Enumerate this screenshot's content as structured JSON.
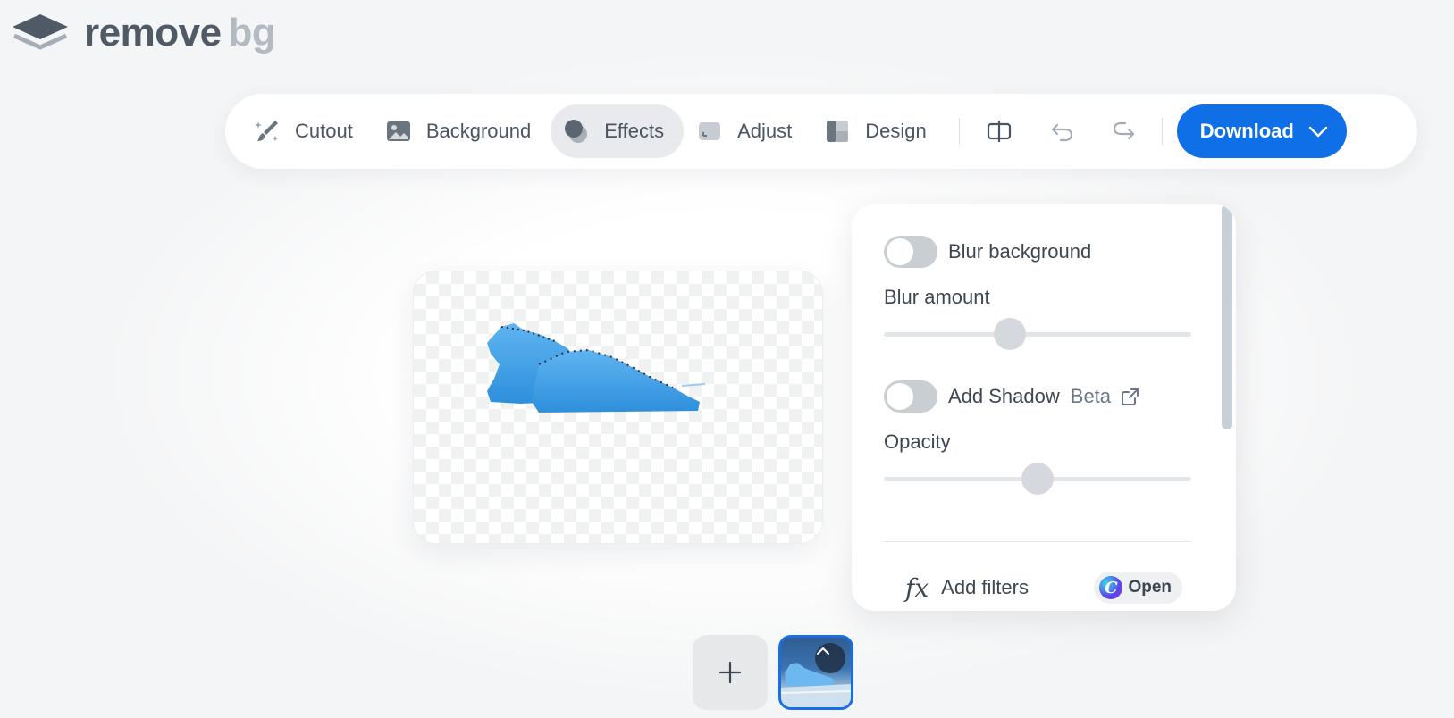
{
  "logo": {
    "word_main": "remove",
    "word_accent": "bg"
  },
  "toolbar": {
    "tools": [
      {
        "label": "Cutout",
        "icon": "brush-sparkle-icon"
      },
      {
        "label": "Background",
        "icon": "image-icon"
      },
      {
        "label": "Effects",
        "icon": "effects-circles-icon",
        "active": true
      },
      {
        "label": "Adjust",
        "icon": "adjust-square-icon"
      },
      {
        "label": "Design",
        "icon": "design-layout-icon"
      }
    ],
    "icon_buttons": [
      "compare-icon",
      "undo-icon",
      "redo-icon"
    ],
    "download_label": "Download"
  },
  "effects_panel": {
    "blur_background": {
      "label": "Blur background",
      "enabled": false
    },
    "blur_amount": {
      "label": "Blur amount",
      "value": 0.41
    },
    "add_shadow": {
      "label": "Add Shadow",
      "badge": "Beta",
      "enabled": false
    },
    "opacity": {
      "label": "Opacity",
      "value": 0.5
    },
    "filters": {
      "icon_text": "fx",
      "label": "Add filters",
      "open_label": "Open",
      "canva_letter": "C"
    }
  },
  "colors": {
    "accent": "#0f6fe6",
    "background": "#f4f5f6",
    "toggle_off": "#c9ced3",
    "iceberg": "#4aa3e8"
  }
}
